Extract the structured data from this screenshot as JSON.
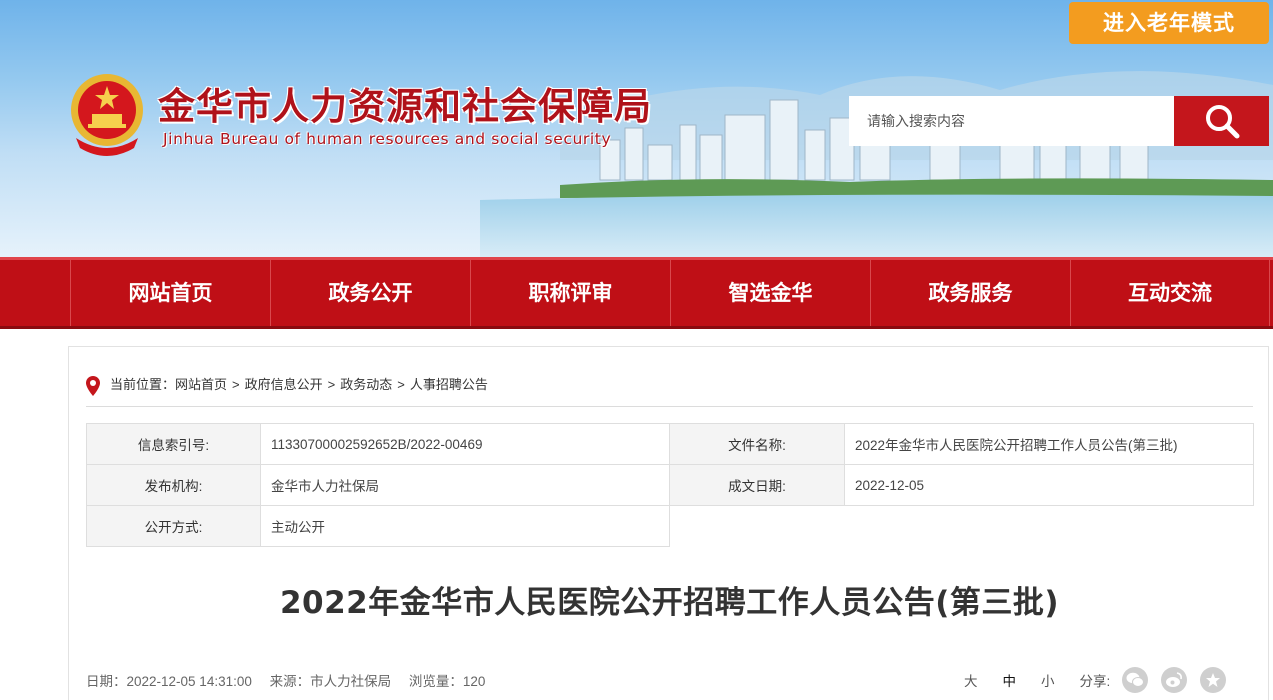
{
  "header": {
    "senior_mode_label": "进入老年模式",
    "site_title": "金华市人力资源和社会保障局",
    "site_subtitle": "Jinhua Bureau of human resources and social security",
    "search_placeholder": "请输入搜索内容"
  },
  "nav": {
    "items": [
      {
        "label": "网站首页"
      },
      {
        "label": "政务公开"
      },
      {
        "label": "职称评审"
      },
      {
        "label": "智选金华"
      },
      {
        "label": "政务服务"
      },
      {
        "label": "互动交流"
      }
    ]
  },
  "breadcrumb": {
    "prefix": "当前位置：",
    "items": [
      "网站首页",
      "政府信息公开",
      "政务动态",
      "人事招聘公告"
    ],
    "separator": ">"
  },
  "meta": {
    "index_label": "信息索引号:",
    "index_value": "11330700002592652B/2022-00469",
    "filename_label": "文件名称:",
    "filename_value": "2022年金华市人民医院公开招聘工作人员公告(第三批)",
    "publisher_label": "发布机构:",
    "publisher_value": "金华市人力社保局",
    "date_label": "成文日期:",
    "date_value": "2022-12-05",
    "method_label": "公开方式:",
    "method_value": "主动公开"
  },
  "article": {
    "title": "2022年金华市人民医院公开招聘工作人员公告(第三批)",
    "date_text": "日期：2022-12-05 14:31:00",
    "source_text": "来源：市人力社保局",
    "views_text": "浏览量：120"
  },
  "tools": {
    "font_large": "大",
    "font_medium": "中",
    "font_small": "小",
    "share_label": "分享:",
    "share_icons": [
      "wechat-icon",
      "weibo-icon",
      "favorite-icon"
    ]
  },
  "colors": {
    "brand_red": "#bf0f16",
    "senior_orange": "#f39c1f",
    "search_red": "#c4161c"
  }
}
